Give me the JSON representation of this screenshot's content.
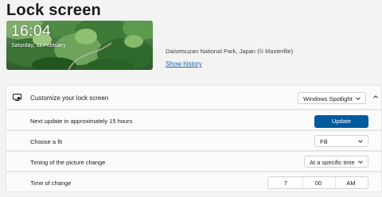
{
  "page": {
    "title": "Lock screen"
  },
  "preview": {
    "time": "16:04",
    "date": "Saturday, 11 February"
  },
  "image_info": {
    "credit": "Daisetsuzan National Park, Japan (© Masterfile)",
    "history_link": "Show history"
  },
  "customize": {
    "label": "Customize your lock screen",
    "value": "Windows Spotlight",
    "icon": "lock-screen-monitor-icon"
  },
  "next_update": {
    "label": "Next update in approximately 15 hours",
    "button": "Update"
  },
  "fit": {
    "label": "Choose a fit",
    "value": "Fill"
  },
  "timing": {
    "label": "Timing of the picture change",
    "value": "At a specific time"
  },
  "time_of_change": {
    "label": "Time of change",
    "hour": "7",
    "minute": "00",
    "period": "AM"
  },
  "colors": {
    "accent": "#005a9e",
    "link": "#1a5fb4",
    "card_bg": "#fbfbfb",
    "page_bg": "#f3f3f3"
  }
}
